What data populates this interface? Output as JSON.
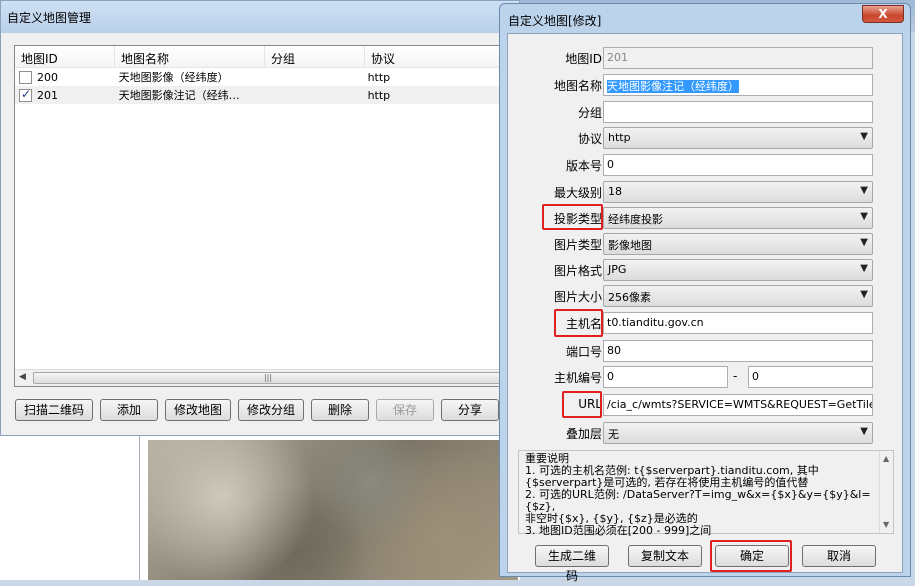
{
  "manager": {
    "title": "自定义地图管理",
    "columns": [
      "地图ID",
      "地图名称",
      "分组",
      "协议"
    ],
    "rows": [
      {
        "id": "200",
        "name": "天地图影像（经纬度）",
        "group": "",
        "protocol": "http",
        "checked": false
      },
      {
        "id": "201",
        "name": "天地图影像注记（经纬…",
        "group": "",
        "protocol": "http",
        "checked": true
      }
    ],
    "buttons": {
      "scan_qr": "扫描二维码",
      "add": "添加",
      "modify_map": "修改地图",
      "modify_group": "修改分组",
      "delete": "删除",
      "save": "保存",
      "share": "分享"
    }
  },
  "editor": {
    "title": "自定义地图[修改]",
    "close": "X",
    "fields": {
      "map_id": {
        "label": "地图ID",
        "value": "201"
      },
      "map_name": {
        "label": "地图名称",
        "value": "天地图影像注记（经纬度）"
      },
      "group": {
        "label": "分组",
        "value": ""
      },
      "protocol": {
        "label": "协议",
        "value": "http"
      },
      "version": {
        "label": "版本号",
        "value": "0"
      },
      "max_level": {
        "label": "最大级别",
        "value": "18"
      },
      "projection": {
        "label": "投影类型",
        "value": "经纬度投影"
      },
      "image_type": {
        "label": "图片类型",
        "value": "影像地图"
      },
      "image_format": {
        "label": "图片格式",
        "value": "JPG"
      },
      "image_size": {
        "label": "图片大小",
        "value": "256像素"
      },
      "host": {
        "label": "主机名",
        "value": "t0.tianditu.gov.cn"
      },
      "port": {
        "label": "端口号",
        "value": "80"
      },
      "host_num": {
        "label": "主机编号",
        "from": "0",
        "sep": "-",
        "to": "0"
      },
      "url": {
        "label": "URL",
        "value": "/cia_c/wmts?SERVICE=WMTS&REQUEST=GetTile&VERSI"
      },
      "overlay": {
        "label": "叠加层",
        "value": "无"
      }
    },
    "notes": {
      "title": "重要说明",
      "line1": "1. 可选的主机名范例: t{$serverpart}.tianditu.com, 其中",
      "line2": "{$serverpart}是可选的, 若存在将使用主机编号的值代替",
      "line3": "2. 可选的URL范例: /DataServer?T=img_w&x={$x}&y={$y}&l={$z},",
      "line4": "非空时{$x}, {$y}, {$z}是必选的",
      "line5": "3. 地图ID范围必须在[200 - 999]之间"
    },
    "buttons": {
      "gen_qr": "生成二维码",
      "copy_text": "复制文本",
      "ok": "确定",
      "cancel": "取消"
    }
  }
}
